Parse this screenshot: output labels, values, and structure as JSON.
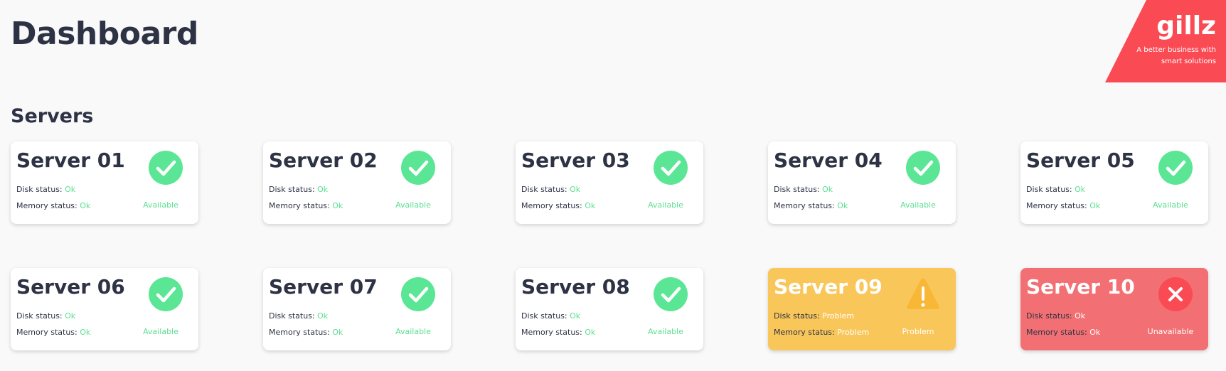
{
  "header": {
    "title": "Dashboard"
  },
  "logo": {
    "name": "gillz",
    "tagline": "A better business with smart solutions",
    "color": "#fa4b54"
  },
  "section": {
    "title": "Servers"
  },
  "labels": {
    "disk": "Disk status:",
    "memory": "Memory status:"
  },
  "colors": {
    "ok": "#5be695",
    "warning": "#f9c65a",
    "error": "#f27073"
  },
  "servers": [
    {
      "name": "Server 01",
      "disk": "Ok",
      "memory": "Ok",
      "state": "Available",
      "status": "ok",
      "icon": "check-icon"
    },
    {
      "name": "Server 02",
      "disk": "Ok",
      "memory": "Ok",
      "state": "Available",
      "status": "ok",
      "icon": "check-icon"
    },
    {
      "name": "Server 03",
      "disk": "Ok",
      "memory": "Ok",
      "state": "Available",
      "status": "ok",
      "icon": "check-icon"
    },
    {
      "name": "Server 04",
      "disk": "Ok",
      "memory": "Ok",
      "state": "Available",
      "status": "ok",
      "icon": "check-icon"
    },
    {
      "name": "Server 05",
      "disk": "Ok",
      "memory": "Ok",
      "state": "Available",
      "status": "ok",
      "icon": "check-icon"
    },
    {
      "name": "Server 06",
      "disk": "Ok",
      "memory": "Ok",
      "state": "Available",
      "status": "ok",
      "icon": "check-icon"
    },
    {
      "name": "Server 07",
      "disk": "Ok",
      "memory": "Ok",
      "state": "Available",
      "status": "ok",
      "icon": "check-icon"
    },
    {
      "name": "Server 08",
      "disk": "Ok",
      "memory": "Ok",
      "state": "Available",
      "status": "ok",
      "icon": "check-icon"
    },
    {
      "name": "Server 09",
      "disk": "Problem",
      "memory": "Problem",
      "state": "Problem",
      "status": "warning",
      "icon": "warning-icon"
    },
    {
      "name": "Server 10",
      "disk": "Ok",
      "memory": "Ok",
      "state": "Unavailable",
      "status": "error",
      "icon": "close-icon"
    }
  ]
}
